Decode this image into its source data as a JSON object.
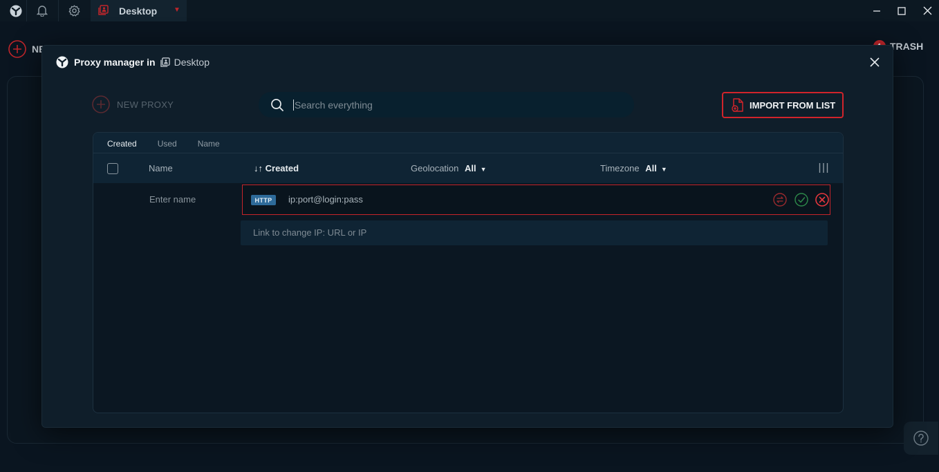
{
  "titlebar": {
    "workspace_tab": "Desktop",
    "icons": [
      "app-logo-icon",
      "bell-icon",
      "gear-icon",
      "workspace-icon"
    ]
  },
  "background": {
    "new_label": "NE",
    "trash_label": "TRASH",
    "trash_count": "1"
  },
  "modal": {
    "title": "Proxy manager",
    "in_word": "in",
    "workspace": "Desktop",
    "new_proxy_label": "NEW PROXY",
    "search_placeholder": "Search everything",
    "import_label": "IMPORT FROM LIST"
  },
  "table": {
    "sort_tabs": [
      {
        "label": "Created",
        "active": true
      },
      {
        "label": "Used",
        "active": false
      },
      {
        "label": "Name",
        "active": false
      }
    ],
    "columns": {
      "name": "Name",
      "created": "Created",
      "sort_arrows": "↓↑",
      "geolocation": "Geolocation",
      "geolocation_filter": "All",
      "timezone": "Timezone",
      "timezone_filter": "All"
    },
    "new_row": {
      "name_placeholder": "Enter name",
      "protocol": "HTTP",
      "proxy_placeholder": "ip:port@login:pass",
      "link_placeholder": "Link to change IP: URL or IP"
    }
  },
  "colors": {
    "accent_red": "#d1242b",
    "confirm_green": "#2d8a4a",
    "badge_blue": "#2e6b9a"
  }
}
